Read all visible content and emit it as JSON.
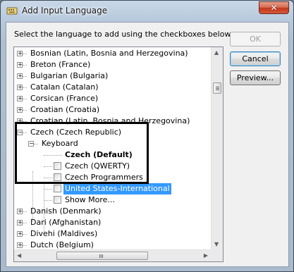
{
  "window": {
    "title": "Add Input Language"
  },
  "instruction": "Select the language to add using the checkboxes below.",
  "buttons": {
    "ok": "OK",
    "cancel": "Cancel",
    "preview": "Preview..."
  },
  "tree": {
    "rows": [
      {
        "label": "Bosnian (Latin, Bosnia and Herzegovina)"
      },
      {
        "label": "Breton (France)"
      },
      {
        "label": "Bulgarian (Bulgaria)"
      },
      {
        "label": "Catalan (Catalan)"
      },
      {
        "label": "Corsican (France)"
      },
      {
        "label": "Croatian (Croatia)"
      },
      {
        "label": "Croatian (Latin, Bosnia and Herzegovina)"
      },
      {
        "label": "Czech (Czech Republic)"
      },
      {
        "label": "Keyboard"
      },
      {
        "label": "Czech (Default)"
      },
      {
        "label": "Czech (QWERTY)"
      },
      {
        "label": "Czech Programmers"
      },
      {
        "label": "United States-International"
      },
      {
        "label": "Show More..."
      },
      {
        "label": "Danish (Denmark)"
      },
      {
        "label": "Dari (Afghanistan)"
      },
      {
        "label": "Divehi (Maldives)"
      },
      {
        "label": "Dutch (Belgium)"
      }
    ]
  },
  "glyphs": {
    "collapsed": "+",
    "expanded": "−",
    "close": "✕",
    "up": "▲",
    "down": "▼",
    "left": "◀",
    "right": "▶"
  },
  "colors": {
    "selection": "#3399ff",
    "close_button": "#c7432a"
  }
}
